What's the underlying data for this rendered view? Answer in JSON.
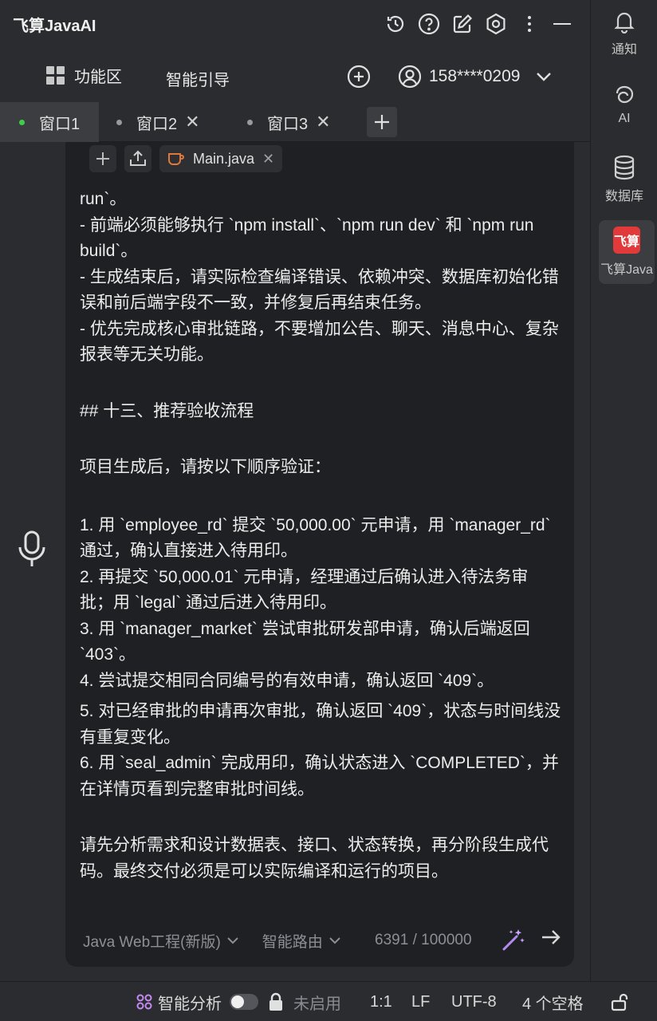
{
  "app": {
    "title": "飞算JavaAI"
  },
  "toolbar": {
    "function_area": "功能区",
    "smart_guide": "智能引导",
    "user_phone": "158****0209"
  },
  "tabs": [
    {
      "label": "窗口1",
      "active": true,
      "dot_color": "#3ecf4a"
    },
    {
      "label": "窗口2",
      "active": false,
      "dot_color": "#9a9a9a"
    },
    {
      "label": "窗口3",
      "active": false,
      "dot_color": "#9a9a9a"
    }
  ],
  "chat": {
    "attachment": "Main.java",
    "lines": [
      "run`。",
      "- 前端必须能够执行 `npm install`、`npm run dev` 和 `npm run build`。",
      "- 生成结束后，请实际检查编译错误、依赖冲突、数据库初始化错误和前后端字段不一致，并修复后再结束任务。",
      "- 优先完成核心审批链路，不要增加公告、聊天、消息中心、复杂报表等无关功能。",
      "## 十三、推荐验收流程",
      "项目生成后，请按以下顺序验证：",
      "1. 用 `employee_rd` 提交 `50,000.00` 元申请，用 `manager_rd` 通过，确认直接进入待用印。",
      "2. 再提交 `50,000.01` 元申请，经理通过后确认进入待法务审批；用 `legal` 通过后进入待用印。",
      "3. 用 `manager_market` 尝试审批研发部申请，确认后端返回 `403`。",
      "4. 尝试提交相同合同编号的有效申请，确认返回 `409`。",
      "5. 对已经审批的申请再次审批，确认返回 `409`，状态与时间线没有重复变化。",
      "6. 用 `seal_admin` 完成用印，确认状态进入 `COMPLETED`，并在详情页看到完整审批时间线。",
      "请先分析需求和设计数据表、接口、状态转换，再分阶段生成代码。最终交付必须是可以实际编译和运行的项目。"
    ],
    "project_type": "Java Web工程(新版)",
    "routing": "智能路由",
    "char_count": "6391",
    "char_sep": "/",
    "char_limit": "100000"
  },
  "sidebar": {
    "notify": "通知",
    "ai": "AI",
    "database": "数据库",
    "app_label": "飞算Java",
    "app_logo_text": "飞算"
  },
  "status": {
    "smart_analysis": "智能分析",
    "disabled": "未启用",
    "position": "1:1",
    "line_ending": "LF",
    "encoding": "UTF-8",
    "indent": "4 个空格"
  }
}
